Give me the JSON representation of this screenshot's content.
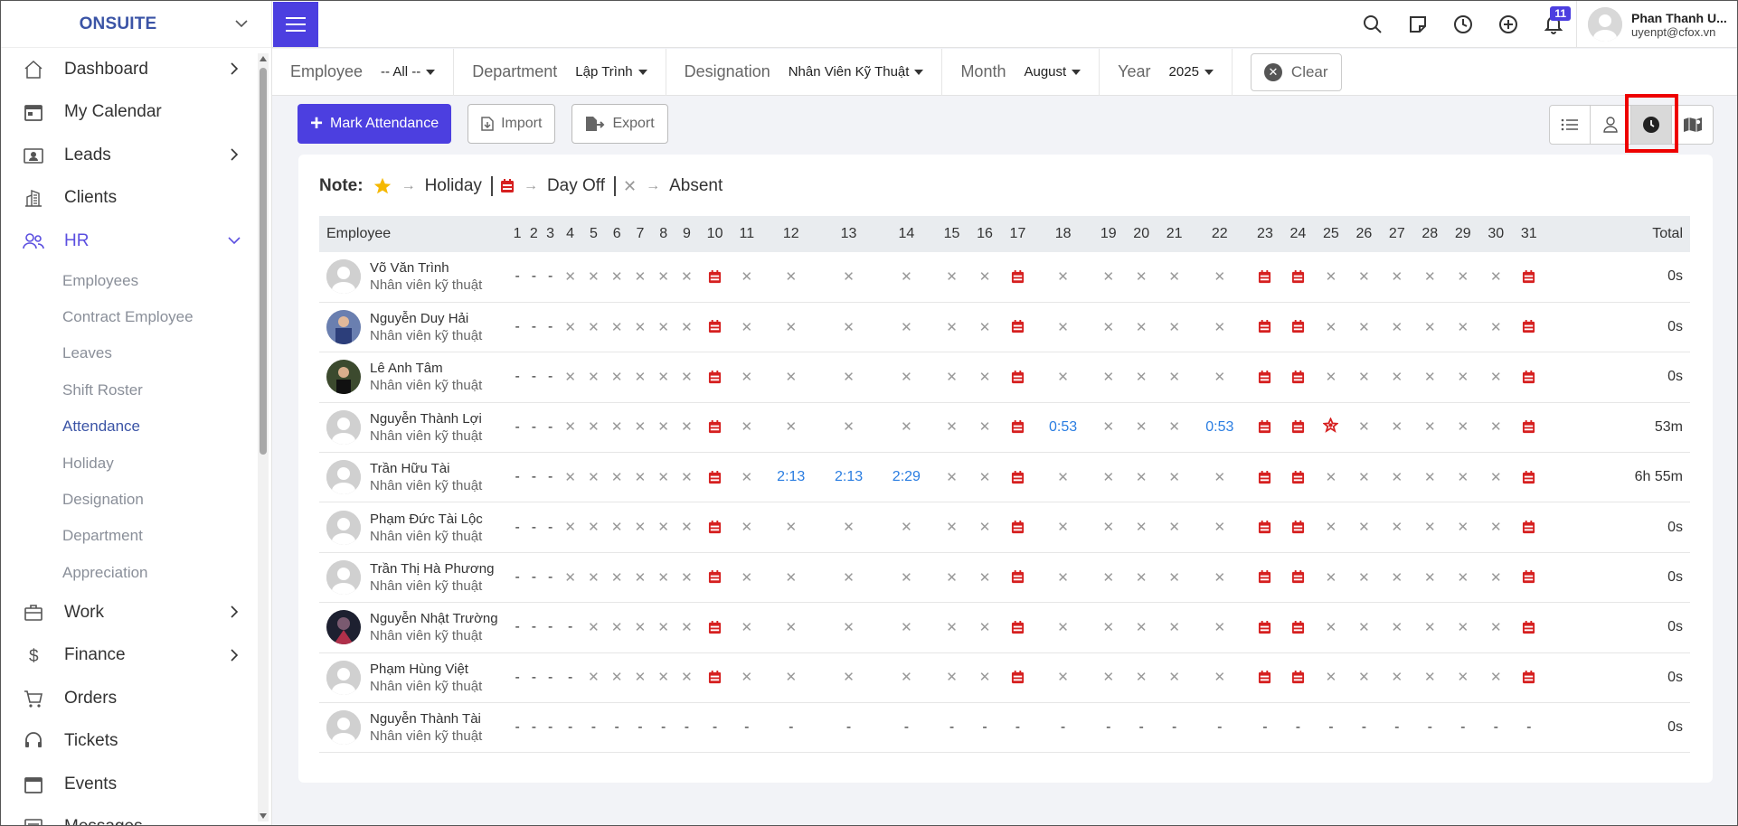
{
  "sidebar": {
    "brand": "ONSUITE",
    "items": [
      {
        "label": "Dashboard",
        "icon": "home-icon",
        "chevron": true
      },
      {
        "label": "My Calendar",
        "icon": "calendar-icon",
        "chevron": false
      },
      {
        "label": "Leads",
        "icon": "id-card-icon",
        "chevron": true
      },
      {
        "label": "Clients",
        "icon": "building-icon",
        "chevron": false
      },
      {
        "label": "HR",
        "icon": "users-icon",
        "chevron": true,
        "expanded": true
      }
    ],
    "hr_sub": [
      "Employees",
      "Contract Employee",
      "Leaves",
      "Shift Roster",
      "Attendance",
      "Holiday",
      "Designation",
      "Department",
      "Appreciation"
    ],
    "hr_active": "Attendance",
    "items_after": [
      {
        "label": "Work",
        "icon": "briefcase-icon",
        "chevron": true
      },
      {
        "label": "Finance",
        "icon": "dollar-icon",
        "chevron": true
      },
      {
        "label": "Orders",
        "icon": "cart-icon",
        "chevron": false
      },
      {
        "label": "Tickets",
        "icon": "headset-icon",
        "chevron": false
      },
      {
        "label": "Events",
        "icon": "event-icon",
        "chevron": false
      },
      {
        "label": "Messages",
        "icon": "message-icon",
        "chevron": false
      }
    ]
  },
  "topbar": {
    "notification_count": "11",
    "user_name": "Phan Thanh U...",
    "user_email": "uyenpt@cfox.vn"
  },
  "filters": {
    "employee_label": "Employee",
    "employee_value": "-- All --",
    "department_label": "Department",
    "department_value": "Lập Trình",
    "designation_label": "Designation",
    "designation_value": "Nhân Viên Kỹ Thuật",
    "month_label": "Month",
    "month_value": "August",
    "year_label": "Year",
    "year_value": "2025",
    "clear_label": "Clear"
  },
  "actions": {
    "mark_attendance": "Mark Attendance",
    "import": "Import",
    "export": "Export"
  },
  "note": {
    "title": "Note:",
    "holiday": "Holiday",
    "day_off": "Day Off",
    "absent": "Absent"
  },
  "table": {
    "employee_header": "Employee",
    "total_header": "Total",
    "days": [
      "1",
      "2",
      "3",
      "4",
      "5",
      "6",
      "7",
      "8",
      "9",
      "10",
      "11",
      "12",
      "13",
      "14",
      "15",
      "16",
      "17",
      "18",
      "19",
      "20",
      "21",
      "22",
      "23",
      "24",
      "25",
      "26",
      "27",
      "28",
      "29",
      "30",
      "31"
    ],
    "rows": [
      {
        "name": "Võ Văn Trình",
        "designation": "Nhân viên kỹ thuật",
        "avatar": "default",
        "total": "0s",
        "cells": [
          "-",
          "-",
          "-",
          "x",
          "x",
          "x",
          "x",
          "x",
          "x",
          "d",
          "x",
          "x",
          "x",
          "x",
          "x",
          "x",
          "d",
          "x",
          "x",
          "x",
          "x",
          "x",
          "d",
          "d",
          "x",
          "x",
          "x",
          "x",
          "x",
          "x",
          "d"
        ]
      },
      {
        "name": "Nguyễn Duy Hải",
        "designation": "Nhân viên kỹ thuật",
        "avatar": "photo1",
        "total": "0s",
        "cells": [
          "-",
          "-",
          "-",
          "x",
          "x",
          "x",
          "x",
          "x",
          "x",
          "d",
          "x",
          "x",
          "x",
          "x",
          "x",
          "x",
          "d",
          "x",
          "x",
          "x",
          "x",
          "x",
          "d",
          "d",
          "x",
          "x",
          "x",
          "x",
          "x",
          "x",
          "d"
        ]
      },
      {
        "name": "Lê Anh Tâm",
        "designation": "Nhân viên kỹ thuật",
        "avatar": "photo2",
        "total": "0s",
        "cells": [
          "-",
          "-",
          "-",
          "x",
          "x",
          "x",
          "x",
          "x",
          "x",
          "d",
          "x",
          "x",
          "x",
          "x",
          "x",
          "x",
          "d",
          "x",
          "x",
          "x",
          "x",
          "x",
          "d",
          "d",
          "x",
          "x",
          "x",
          "x",
          "x",
          "x",
          "d"
        ]
      },
      {
        "name": "Nguyễn Thành Lợi",
        "designation": "Nhân viên kỹ thuật",
        "avatar": "default",
        "total": "53m",
        "cells": [
          "-",
          "-",
          "-",
          "x",
          "x",
          "x",
          "x",
          "x",
          "x",
          "d",
          "x",
          "x",
          "x",
          "x",
          "x",
          "x",
          "d",
          "0:53",
          "x",
          "x",
          "x",
          "0:53",
          "d",
          "d",
          "h",
          "x",
          "x",
          "x",
          "x",
          "x",
          "d"
        ]
      },
      {
        "name": "Trần Hữu Tài",
        "designation": "Nhân viên kỹ thuật",
        "avatar": "default",
        "total": "6h 55m",
        "cells": [
          "-",
          "-",
          "-",
          "x",
          "x",
          "x",
          "x",
          "x",
          "x",
          "d",
          "x",
          "2:13",
          "2:13",
          "2:29",
          "x",
          "x",
          "d",
          "x",
          "x",
          "x",
          "x",
          "x",
          "d",
          "d",
          "x",
          "x",
          "x",
          "x",
          "x",
          "x",
          "d"
        ]
      },
      {
        "name": "Phạm Đức Tài Lộc",
        "designation": "Nhân viên kỹ thuật",
        "avatar": "default",
        "total": "0s",
        "cells": [
          "-",
          "-",
          "-",
          "x",
          "x",
          "x",
          "x",
          "x",
          "x",
          "d",
          "x",
          "x",
          "x",
          "x",
          "x",
          "x",
          "d",
          "x",
          "x",
          "x",
          "x",
          "x",
          "d",
          "d",
          "x",
          "x",
          "x",
          "x",
          "x",
          "x",
          "d"
        ]
      },
      {
        "name": "Trần Thị Hà Phương",
        "designation": "Nhân viên kỹ thuật",
        "avatar": "default",
        "total": "0s",
        "cells": [
          "-",
          "-",
          "-",
          "x",
          "x",
          "x",
          "x",
          "x",
          "x",
          "d",
          "x",
          "x",
          "x",
          "x",
          "x",
          "x",
          "d",
          "x",
          "x",
          "x",
          "x",
          "x",
          "d",
          "d",
          "x",
          "x",
          "x",
          "x",
          "x",
          "x",
          "d"
        ]
      },
      {
        "name": "Nguyễn Nhật Trường",
        "designation": "Nhân viên kỹ thuật",
        "avatar": "photo3",
        "total": "0s",
        "cells": [
          "-",
          "-",
          "-",
          "-",
          "x",
          "x",
          "x",
          "x",
          "x",
          "d",
          "x",
          "x",
          "x",
          "x",
          "x",
          "x",
          "d",
          "x",
          "x",
          "x",
          "x",
          "x",
          "d",
          "d",
          "x",
          "x",
          "x",
          "x",
          "x",
          "x",
          "d"
        ]
      },
      {
        "name": "Phạm Hùng Việt",
        "designation": "Nhân viên kỹ thuật",
        "avatar": "default",
        "total": "0s",
        "cells": [
          "-",
          "-",
          "-",
          "-",
          "x",
          "x",
          "x",
          "x",
          "x",
          "d",
          "x",
          "x",
          "x",
          "x",
          "x",
          "x",
          "d",
          "x",
          "x",
          "x",
          "x",
          "x",
          "d",
          "d",
          "x",
          "x",
          "x",
          "x",
          "x",
          "x",
          "d"
        ]
      },
      {
        "name": "Nguyễn Thành Tài",
        "designation": "Nhân viên kỹ thuật",
        "avatar": "default",
        "total": "0s",
        "cells": [
          "-",
          "-",
          "-",
          "-",
          "-",
          "-",
          "-",
          "-",
          "-",
          "-",
          "-",
          "-",
          "-",
          "-",
          "-",
          "-",
          "-",
          "-",
          "-",
          "-",
          "-",
          "-",
          "-",
          "-",
          "-",
          "-",
          "-",
          "-",
          "-",
          "-",
          "-"
        ]
      }
    ]
  },
  "colors": {
    "accent": "#4c3fe0",
    "brand": "#3b54a6",
    "dayoff": "#d62020",
    "time": "#2a7de1",
    "highlight": "#e00000"
  }
}
